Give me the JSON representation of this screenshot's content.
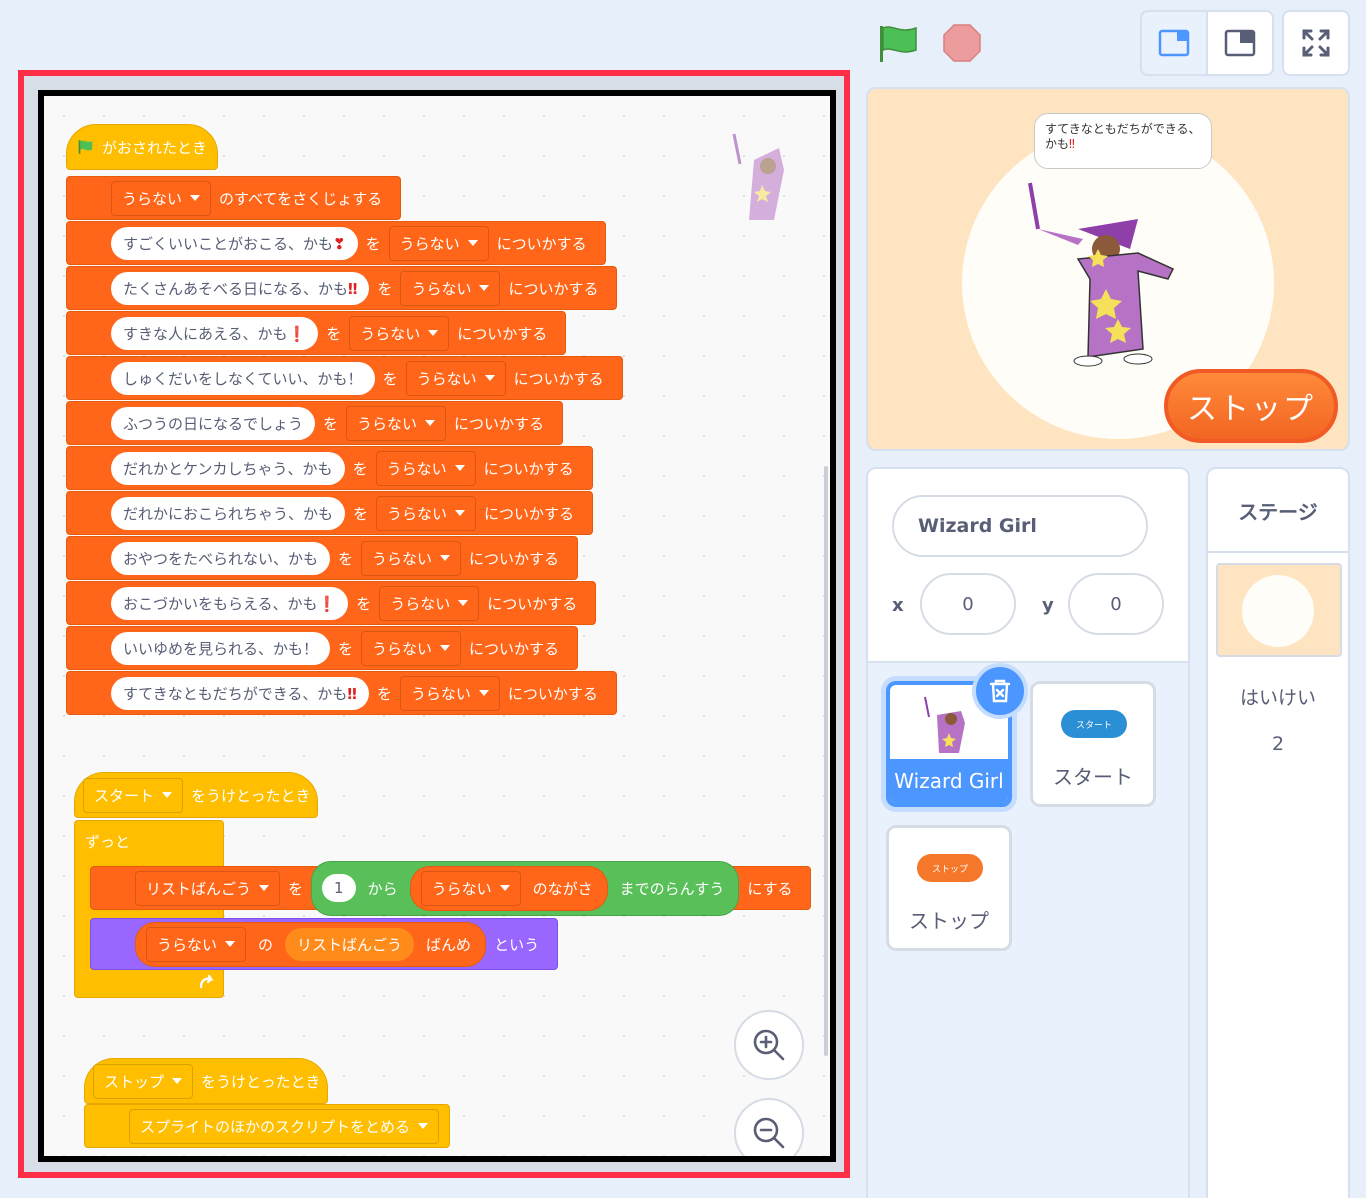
{
  "topbar": {
    "green_flag": "green-flag-icon",
    "stop": "stop-icon",
    "layout_small": "small-stage-icon",
    "layout_large": "large-stage-icon",
    "fullscreen": "fullscreen-icon"
  },
  "script1": {
    "hat": "がおされたとき",
    "clear": {
      "list": "うらない",
      "text": "のすべてをさくじょする"
    },
    "add_op": "を",
    "add_tail": "についかする",
    "list": "うらない",
    "items": [
      {
        "text": "すごくいいことがおこる、かも",
        "mark": "❣"
      },
      {
        "text": "たくさんあそべる日になる、かも",
        "mark": "‼"
      },
      {
        "text": "すきな人にあえる、かも",
        "mark": "❗"
      },
      {
        "text": "しゅくだいをしなくていい、かも！",
        "mark": ""
      },
      {
        "text": "ふつうの日になるでしょう",
        "mark": ""
      },
      {
        "text": "だれかとケンカしちゃう、かも",
        "mark": ""
      },
      {
        "text": "だれかにおこられちゃう、かも",
        "mark": ""
      },
      {
        "text": "おやつをたべられない、かも",
        "mark": ""
      },
      {
        "text": "おこづかいをもらえる、かも",
        "mark": "❗"
      },
      {
        "text": "いいゆめを見られる、かも！",
        "mark": ""
      },
      {
        "text": "すてきなともだちができる、かも",
        "mark": "‼"
      }
    ]
  },
  "script2": {
    "hat_msg": "スタート",
    "hat_tail": "をうけとったとき",
    "forever": "ずっと",
    "set_var": "リストばんごう",
    "set_op": "を",
    "from_val": "1",
    "from_lbl": "から",
    "len_list": "うらない",
    "len_lbl": "のながさ",
    "rand_tail": "までのらんすう",
    "set_tail": "にする",
    "say_list": "うらない",
    "say_of": "の",
    "say_var": "リストばんごう",
    "say_nth": "ばんめ",
    "say_tail": "という"
  },
  "script3": {
    "hat_msg": "ストップ",
    "hat_tail": "をうけとったとき",
    "stop_opt": "スプライトのほかのスクリプトをとめる"
  },
  "stage": {
    "bubble": "すてきなともだちができる、かも",
    "bubble_mark": "‼",
    "stop_button": "ストップ"
  },
  "sprite_info": {
    "name": "Wizard Girl",
    "x_label": "x",
    "x": "0",
    "y_label": "y",
    "y": "0"
  },
  "sprites": [
    {
      "name": "Wizard Girl",
      "selected": true
    },
    {
      "name": "スタート",
      "badge": "スタート",
      "color": "#2b8fd6"
    },
    {
      "name": "ストップ",
      "badge": "ストップ",
      "color": "#f5782a"
    }
  ],
  "stage_pane": {
    "title": "ステージ",
    "backdrops_label": "はいけい",
    "backdrops_count": "2"
  },
  "colors": {
    "motion_orange": "#ff6619",
    "events_yellow": "#ffbf00",
    "looks_purple": "#9966ff",
    "operator_green": "#59c059",
    "accent": "#4c97ff",
    "highlight": "#ff2e47"
  }
}
